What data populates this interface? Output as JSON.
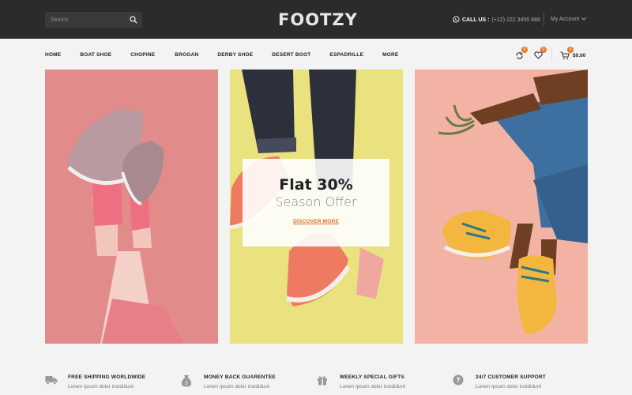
{
  "header": {
    "search_placeholder": "Search",
    "logo": "FOOTZY",
    "contact_label": "CALL US :",
    "contact_phone": "(+12) 222 3456 888",
    "account_label": "My Account"
  },
  "nav": {
    "items": [
      "HOME",
      "BOAT SHOE",
      "CHOPINE",
      "BROGAN",
      "DERBY SHOE",
      "DESERT BOOT",
      "ESPADRILLE",
      "MORE"
    ],
    "compare_count": "0",
    "wishlist_count": "0",
    "cart_count": "0",
    "cart_total": "$0.00"
  },
  "promo": {
    "title": "Flat 30%",
    "subtitle": "Season Offer",
    "link": "DISCOVER MORE"
  },
  "features": [
    {
      "title": "FREE SHIPPING WORLDWIDE",
      "desc": "Lorem ipsum dolor incididunt",
      "icon": "truck-icon"
    },
    {
      "title": "MONEY BACK GUARENTEE",
      "desc": "Lorem ipsum dolor incididunt",
      "icon": "money-bag-icon"
    },
    {
      "title": "WEEKLY SPECIAL GIFTS",
      "desc": "Lorem ipsum dolor incididunt",
      "icon": "gift-icon"
    },
    {
      "title": "24/7 CUSTOMER SUPPORT",
      "desc": "Lorem ipsum dolor incididunt",
      "icon": "help-icon"
    }
  ],
  "colors": {
    "accent": "#e8762b",
    "header_bg": "#2b2b2b",
    "banner_pink": "#e28b8b",
    "banner_yellow": "#e9e27e",
    "banner_peach": "#f2b3a4"
  }
}
